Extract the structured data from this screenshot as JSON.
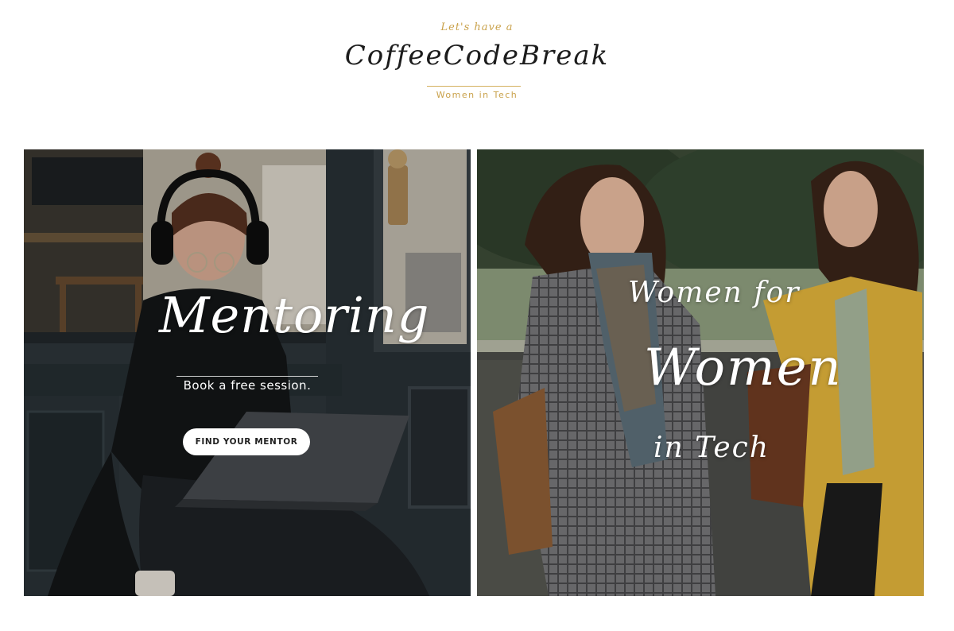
{
  "header": {
    "tagline_top": "Let's have a",
    "brand": "CoffeeCodeBreak",
    "tagline_bottom": "Women in Tech",
    "accent_color": "#c9a14a"
  },
  "mentoring_panel": {
    "title": "Mentoring",
    "subtitle": "Book a free session.",
    "cta_label": "FIND YOUR MENTOR"
  },
  "community_panel": {
    "line1": "Women for",
    "line2": "Women",
    "line3": "in Tech"
  }
}
